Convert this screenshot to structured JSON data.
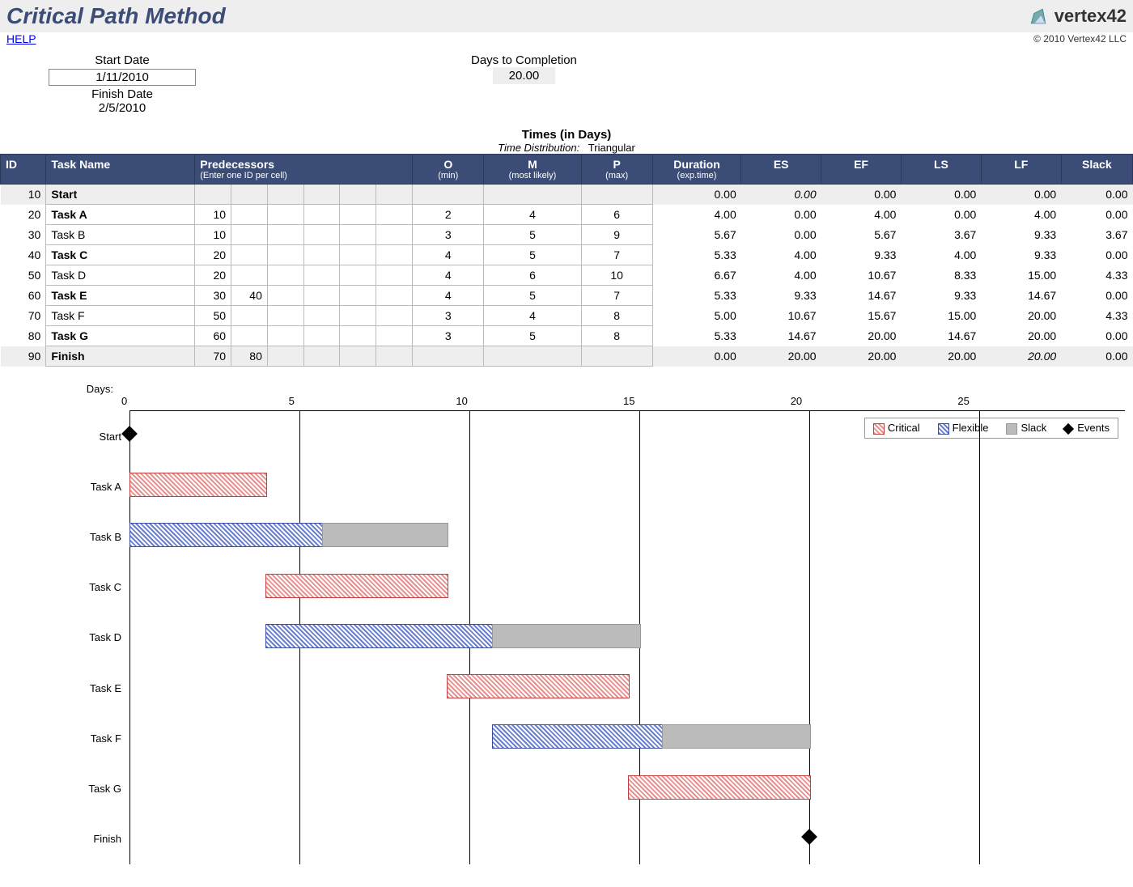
{
  "title": "Critical Path Method",
  "brand": "vertex42",
  "help": "HELP",
  "copyright": "© 2010 Vertex42 LLC",
  "info": {
    "start_label": "Start Date",
    "start_value": "1/11/2010",
    "finish_label": "Finish Date",
    "finish_value": "2/5/2010",
    "days_label": "Days to Completion",
    "days_value": "20.00"
  },
  "times_heading": "Times (in Days)",
  "time_dist_label": "Time Distribution:",
  "time_dist_value": "Triangular",
  "columns": {
    "id": "ID",
    "task": "Task Name",
    "pred": "Predecessors",
    "pred_sub": "(Enter one ID per cell)",
    "o": "O",
    "o_sub": "(min)",
    "m": "M",
    "m_sub": "(most likely)",
    "p": "P",
    "p_sub": "(max)",
    "dur": "Duration",
    "dur_sub": "(exp.time)",
    "es": "ES",
    "ef": "EF",
    "ls": "LS",
    "lf": "LF",
    "slack": "Slack"
  },
  "tasks": [
    {
      "id": "10",
      "name": "Start",
      "bold": true,
      "shade": true,
      "preds": [
        "",
        "",
        "",
        "",
        "",
        ""
      ],
      "o": "",
      "m": "",
      "p": "",
      "dur": "0.00",
      "es": "0.00",
      "es_italic": true,
      "ef": "0.00",
      "ls": "0.00",
      "lf": "0.00",
      "slack": "0.00"
    },
    {
      "id": "20",
      "name": "Task A",
      "bold": true,
      "preds": [
        "10",
        "",
        "",
        "",
        "",
        ""
      ],
      "o": "2",
      "m": "4",
      "p": "6",
      "dur": "4.00",
      "es": "0.00",
      "ef": "4.00",
      "ls": "0.00",
      "lf": "4.00",
      "slack": "0.00"
    },
    {
      "id": "30",
      "name": "Task B",
      "preds": [
        "10",
        "",
        "",
        "",
        "",
        ""
      ],
      "o": "3",
      "m": "5",
      "p": "9",
      "dur": "5.67",
      "es": "0.00",
      "ef": "5.67",
      "ls": "3.67",
      "lf": "9.33",
      "slack": "3.67"
    },
    {
      "id": "40",
      "name": "Task C",
      "bold": true,
      "preds": [
        "20",
        "",
        "",
        "",
        "",
        ""
      ],
      "o": "4",
      "m": "5",
      "p": "7",
      "dur": "5.33",
      "es": "4.00",
      "ef": "9.33",
      "ls": "4.00",
      "lf": "9.33",
      "slack": "0.00"
    },
    {
      "id": "50",
      "name": "Task D",
      "preds": [
        "20",
        "",
        "",
        "",
        "",
        ""
      ],
      "o": "4",
      "m": "6",
      "p": "10",
      "dur": "6.67",
      "es": "4.00",
      "ef": "10.67",
      "ls": "8.33",
      "lf": "15.00",
      "slack": "4.33"
    },
    {
      "id": "60",
      "name": "Task E",
      "bold": true,
      "preds": [
        "30",
        "40",
        "",
        "",
        "",
        ""
      ],
      "o": "4",
      "m": "5",
      "p": "7",
      "dur": "5.33",
      "es": "9.33",
      "ef": "14.67",
      "ls": "9.33",
      "lf": "14.67",
      "slack": "0.00"
    },
    {
      "id": "70",
      "name": "Task F",
      "preds": [
        "50",
        "",
        "",
        "",
        "",
        ""
      ],
      "o": "3",
      "m": "4",
      "p": "8",
      "dur": "5.00",
      "es": "10.67",
      "ef": "15.67",
      "ls": "15.00",
      "lf": "20.00",
      "slack": "4.33"
    },
    {
      "id": "80",
      "name": "Task G",
      "bold": true,
      "preds": [
        "60",
        "",
        "",
        "",
        "",
        ""
      ],
      "o": "3",
      "m": "5",
      "p": "8",
      "dur": "5.33",
      "es": "14.67",
      "ef": "20.00",
      "ls": "14.67",
      "lf": "20.00",
      "slack": "0.00"
    },
    {
      "id": "90",
      "name": "Finish",
      "bold": true,
      "shade": true,
      "preds": [
        "70",
        "80",
        "",
        "",
        "",
        ""
      ],
      "o": "",
      "m": "",
      "p": "",
      "dur": "0.00",
      "es": "20.00",
      "ef": "20.00",
      "ls": "20.00",
      "lf": "20.00",
      "lf_italic": true,
      "slack": "0.00"
    }
  ],
  "chart_data": {
    "type": "bar",
    "xlabel": "Days:",
    "x_ticks": [
      0,
      5,
      10,
      15,
      20,
      25
    ],
    "xlim": [
      0,
      25
    ],
    "legend": {
      "critical": "Critical",
      "flexible": "Flexible",
      "slack": "Slack",
      "events": "Events"
    },
    "rows": [
      {
        "label": "Start",
        "event_at": 0
      },
      {
        "label": "Task A",
        "segments": [
          {
            "type": "critical",
            "from": 0,
            "to": 4
          }
        ]
      },
      {
        "label": "Task B",
        "segments": [
          {
            "type": "flexible",
            "from": 0,
            "to": 5.67
          },
          {
            "type": "slack",
            "from": 5.67,
            "to": 9.33
          }
        ]
      },
      {
        "label": "Task C",
        "segments": [
          {
            "type": "critical",
            "from": 4,
            "to": 9.33
          }
        ]
      },
      {
        "label": "Task D",
        "segments": [
          {
            "type": "flexible",
            "from": 4,
            "to": 10.67
          },
          {
            "type": "slack",
            "from": 10.67,
            "to": 15
          }
        ]
      },
      {
        "label": "Task E",
        "segments": [
          {
            "type": "critical",
            "from": 9.33,
            "to": 14.67
          }
        ]
      },
      {
        "label": "Task F",
        "segments": [
          {
            "type": "flexible",
            "from": 10.67,
            "to": 15.67
          },
          {
            "type": "slack",
            "from": 15.67,
            "to": 20
          }
        ]
      },
      {
        "label": "Task G",
        "segments": [
          {
            "type": "critical",
            "from": 14.67,
            "to": 20
          }
        ]
      },
      {
        "label": "Finish",
        "event_at": 20
      }
    ]
  }
}
